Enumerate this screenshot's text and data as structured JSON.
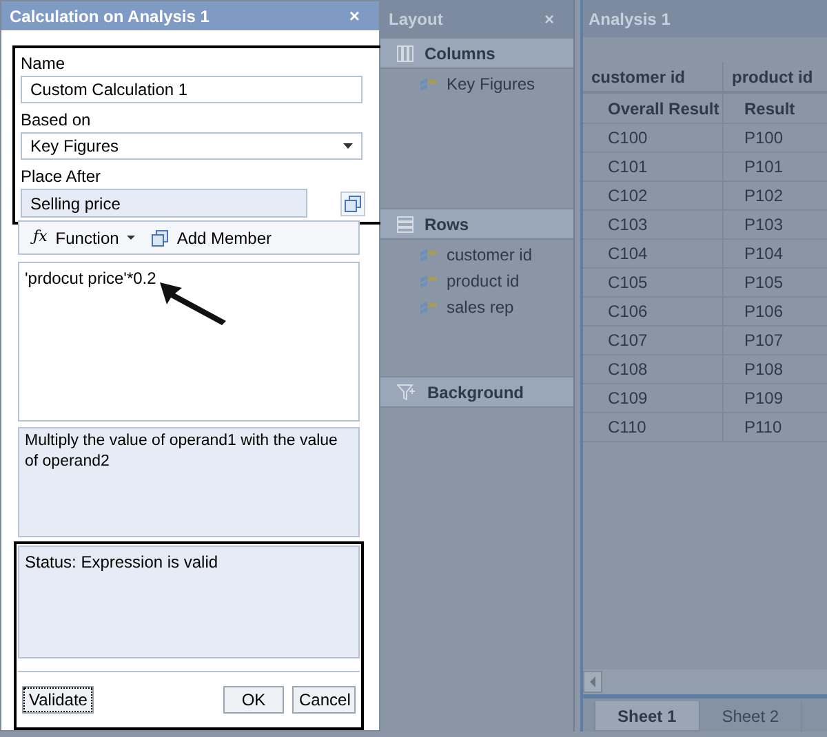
{
  "dialog": {
    "title": "Calculation on Analysis 1",
    "close": "×",
    "name_label": "Name",
    "name_value": "Custom Calculation 1",
    "based_on_label": "Based on",
    "based_on_value": "Key Figures",
    "place_after_label": "Place After",
    "place_after_value": "Selling price",
    "toolbar": [
      {
        "kind": "function",
        "icon": "ƒx",
        "label": "Function"
      },
      {
        "kind": "member",
        "label": "Add Member"
      }
    ],
    "expression": "'prdocut price'*0.2",
    "description": "Multiply the value of operand1 with the value of operand2",
    "status": "Status: Expression is valid",
    "buttons": [
      {
        "kind": "left",
        "label": "Validate"
      },
      {
        "kind": "right",
        "label": "OK"
      },
      {
        "kind": "right",
        "label": "Cancel"
      }
    ]
  },
  "layout": {
    "title": "Layout",
    "close": "×",
    "sections": [
      {
        "kind": "columns",
        "title": "Columns",
        "items": [
          "Key Figures"
        ]
      },
      {
        "kind": "rows",
        "title": "Rows",
        "items": [
          "customer id",
          "product id",
          "sales rep"
        ]
      },
      {
        "kind": "background",
        "title": "Background"
      }
    ]
  },
  "analysis": {
    "title": "Analysis 1",
    "columns": [
      "customer id",
      "product id"
    ],
    "subheaders": [
      "Overall Result",
      "Result"
    ],
    "rows": [
      [
        "C100",
        "P100"
      ],
      [
        "C101",
        "P101"
      ],
      [
        "C102",
        "P102"
      ],
      [
        "C103",
        "P103"
      ],
      [
        "C104",
        "P104"
      ],
      [
        "C105",
        "P105"
      ],
      [
        "C106",
        "P106"
      ],
      [
        "C107",
        "P107"
      ],
      [
        "C108",
        "P108"
      ],
      [
        "C109",
        "P109"
      ],
      [
        "C110",
        "P110"
      ]
    ],
    "sheets": [
      {
        "label": "Sheet 1",
        "selected": true
      },
      {
        "label": "Sheet 2",
        "selected": false
      }
    ]
  }
}
